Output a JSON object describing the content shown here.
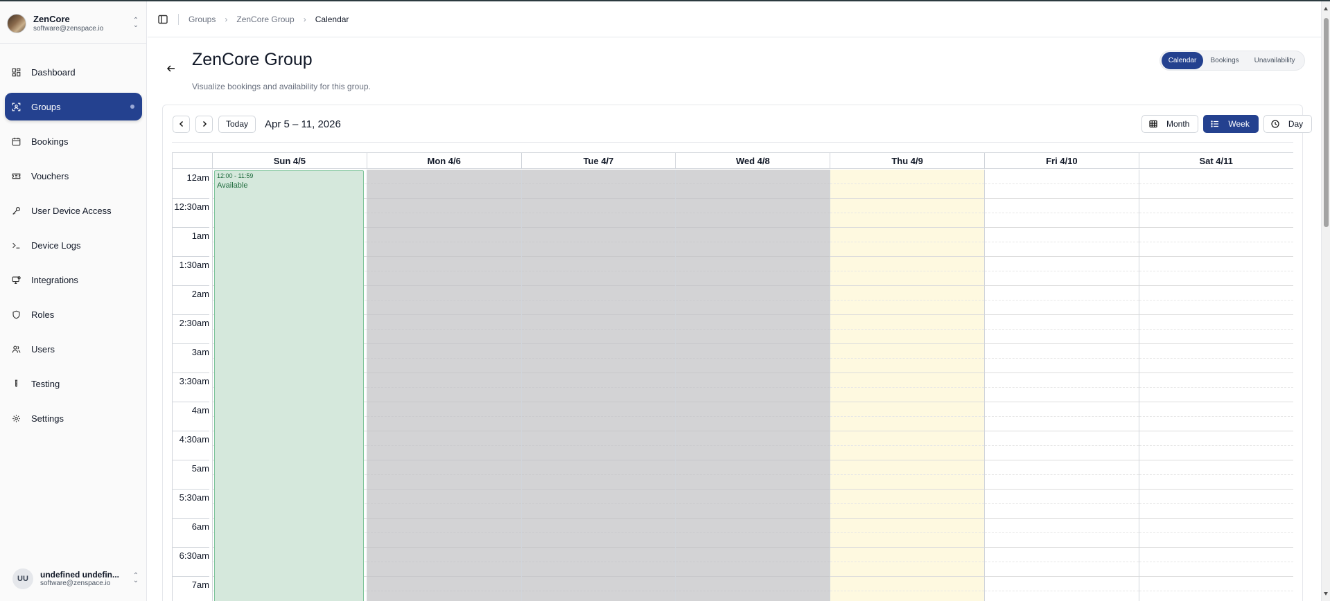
{
  "org": {
    "name": "ZenCore",
    "email": "software@zenspace.io"
  },
  "nav": [
    {
      "label": "Dashboard",
      "icon": "dashboard-icon"
    },
    {
      "label": "Groups",
      "icon": "groups-icon",
      "active": true
    },
    {
      "label": "Bookings",
      "icon": "calendar-icon"
    },
    {
      "label": "Vouchers",
      "icon": "ticket-icon"
    },
    {
      "label": "User Device Access",
      "icon": "key-icon"
    },
    {
      "label": "Device Logs",
      "icon": "terminal-icon"
    },
    {
      "label": "Integrations",
      "icon": "monitor-icon"
    },
    {
      "label": "Roles",
      "icon": "shield-icon"
    },
    {
      "label": "Users",
      "icon": "users-icon"
    },
    {
      "label": "Testing",
      "icon": "test-tube-icon"
    },
    {
      "label": "Settings",
      "icon": "gear-icon"
    }
  ],
  "user": {
    "initials": "UU",
    "name": "undefined undefin...",
    "email": "software@zenspace.io"
  },
  "breadcrumb": [
    "Groups",
    "ZenCore Group",
    "Calendar"
  ],
  "page": {
    "title": "ZenCore Group",
    "subtitle": "Visualize bookings and availability for this group."
  },
  "tabs": [
    {
      "label": "Calendar",
      "active": true
    },
    {
      "label": "Bookings"
    },
    {
      "label": "Unavailability"
    }
  ],
  "calendar": {
    "today_label": "Today",
    "range_label": "Apr 5 – 11, 2026",
    "views": [
      {
        "label": "Month",
        "icon": "grid-icon"
      },
      {
        "label": "Week",
        "icon": "list-icon",
        "active": true
      },
      {
        "label": "Day",
        "icon": "clock-icon"
      }
    ],
    "days": [
      {
        "label": "Sun 4/5",
        "state": "open"
      },
      {
        "label": "Mon 4/6",
        "state": "closed"
      },
      {
        "label": "Tue 4/7",
        "state": "closed"
      },
      {
        "label": "Wed 4/8",
        "state": "closed"
      },
      {
        "label": "Thu 4/9",
        "state": "today"
      },
      {
        "label": "Fri 4/10",
        "state": "open"
      },
      {
        "label": "Sat 4/11",
        "state": "open"
      }
    ],
    "times": [
      "12am",
      "12:30am",
      "1am",
      "1:30am",
      "2am",
      "2:30am",
      "3am",
      "3:30am",
      "4am",
      "4:30am",
      "5am",
      "5:30am",
      "6am",
      "6:30am",
      "7am"
    ],
    "event": {
      "time": "12:00 - 11:59",
      "title": "Available",
      "color": "#d5e8dc"
    }
  },
  "colors": {
    "accent": "#24418f",
    "closed_day": "#d3d3d5",
    "today_day": "#fef9e0"
  }
}
